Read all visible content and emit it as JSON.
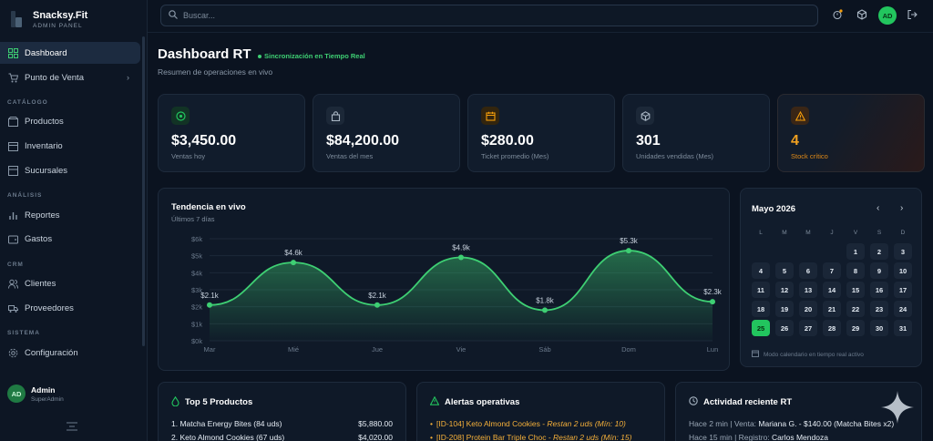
{
  "brand": {
    "name": "Snacksy.Fit",
    "subtitle": "ADMIN PANEL"
  },
  "sidebar": {
    "items": [
      {
        "label": "Dashboard",
        "icon": "grid-icon",
        "active": true
      },
      {
        "label": "Punto de Venta",
        "icon": "cart-icon"
      },
      {
        "label": "Productos",
        "icon": "box-icon"
      },
      {
        "label": "Inventario",
        "icon": "clipboard-icon"
      },
      {
        "label": "Sucursales",
        "icon": "store-icon"
      },
      {
        "label": "Reportes",
        "icon": "bar-chart-icon"
      },
      {
        "label": "Gastos",
        "icon": "wallet-icon"
      },
      {
        "label": "Clientes",
        "icon": "users-icon"
      },
      {
        "label": "Proveedores",
        "icon": "truck-icon"
      },
      {
        "label": "Configuración",
        "icon": "gear-icon"
      }
    ],
    "sections": [
      "CATÁLOGO",
      "ANÁLISIS",
      "CRM",
      "SISTEMA"
    ],
    "user": {
      "initials": "AD",
      "name": "Admin",
      "role": "SuperAdmin"
    }
  },
  "topbar": {
    "search_placeholder": "Buscar...",
    "avatar_initials": "AD"
  },
  "header": {
    "title": "Dashboard RT",
    "sync_status": "Sincronización en Tiempo Real",
    "subtitle": "Resumen de operaciones en vivo"
  },
  "kpis": [
    {
      "value": "$3,450.00",
      "label": "Ventas hoy",
      "icon": "dollar-icon",
      "color": "#22c55e"
    },
    {
      "value": "$84,200.00",
      "label": "Ventas del mes",
      "icon": "bag-icon",
      "color": "#a9b6c4"
    },
    {
      "value": "$280.00",
      "label": "Ticket promedio (Mes)",
      "icon": "calendar-icon",
      "color": "#f59e0b"
    },
    {
      "value": "301",
      "label": "Unidades vendidas (Mes)",
      "icon": "cube-icon",
      "color": "#a9b6c4"
    },
    {
      "value": "4",
      "label": "Stock crítico",
      "icon": "warning-icon",
      "color": "#f59e0b"
    }
  ],
  "chart_data": {
    "type": "area",
    "title": "Tendencia en vivo",
    "subtitle": "Últimos 7 días",
    "categories": [
      "Mar",
      "Mié",
      "Jue",
      "Vie",
      "Sáb",
      "Dom",
      "Lun"
    ],
    "values": [
      2100,
      4600,
      2100,
      4900,
      1800,
      5300,
      2300
    ],
    "data_labels": [
      "$2.1k",
      "$4.6k",
      "$2.1k",
      "$4.9k",
      "$1.8k",
      "$5.3k",
      "$2.3k"
    ],
    "ytick_labels": [
      "$0k",
      "$1k",
      "$2k",
      "$3k",
      "$4k",
      "$5k",
      "$6k"
    ],
    "ylim": [
      0,
      6000
    ],
    "color": "#3ecf73"
  },
  "calendar": {
    "title": "Mayo 2026",
    "weekdays": [
      "L",
      "M",
      "M",
      "J",
      "V",
      "S",
      "D"
    ],
    "first_weekday_index": 4,
    "days_in_month": 31,
    "today": 25,
    "note": "Modo calendario en tiempo real activo"
  },
  "top_products": {
    "title": "Top 5 Productos",
    "rows": [
      {
        "name": "1. Matcha Energy Bites (84 uds)",
        "amount": "$5,880.00"
      },
      {
        "name": "2. Keto Almond Cookies (67 uds)",
        "amount": "$4,020.00"
      }
    ]
  },
  "alerts": {
    "title": "Alertas operativas",
    "rows": [
      {
        "text": "[ID-104] Keto Almond Cookies - ",
        "detail": "Restan 2 uds (Mín: 10)"
      },
      {
        "text": "[ID-208] Protein Bar Triple Choc - ",
        "detail": "Restan 2 uds (Mín: 15)"
      }
    ]
  },
  "activity": {
    "title": "Actividad reciente RT",
    "rows": [
      {
        "prefix": "Hace 2 min | Venta: ",
        "detail": "Mariana G. - $140.00 (Matcha Bites x2)"
      },
      {
        "prefix": "Hace 15 min | Registro: ",
        "detail": "Carlos Mendoza"
      }
    ]
  }
}
